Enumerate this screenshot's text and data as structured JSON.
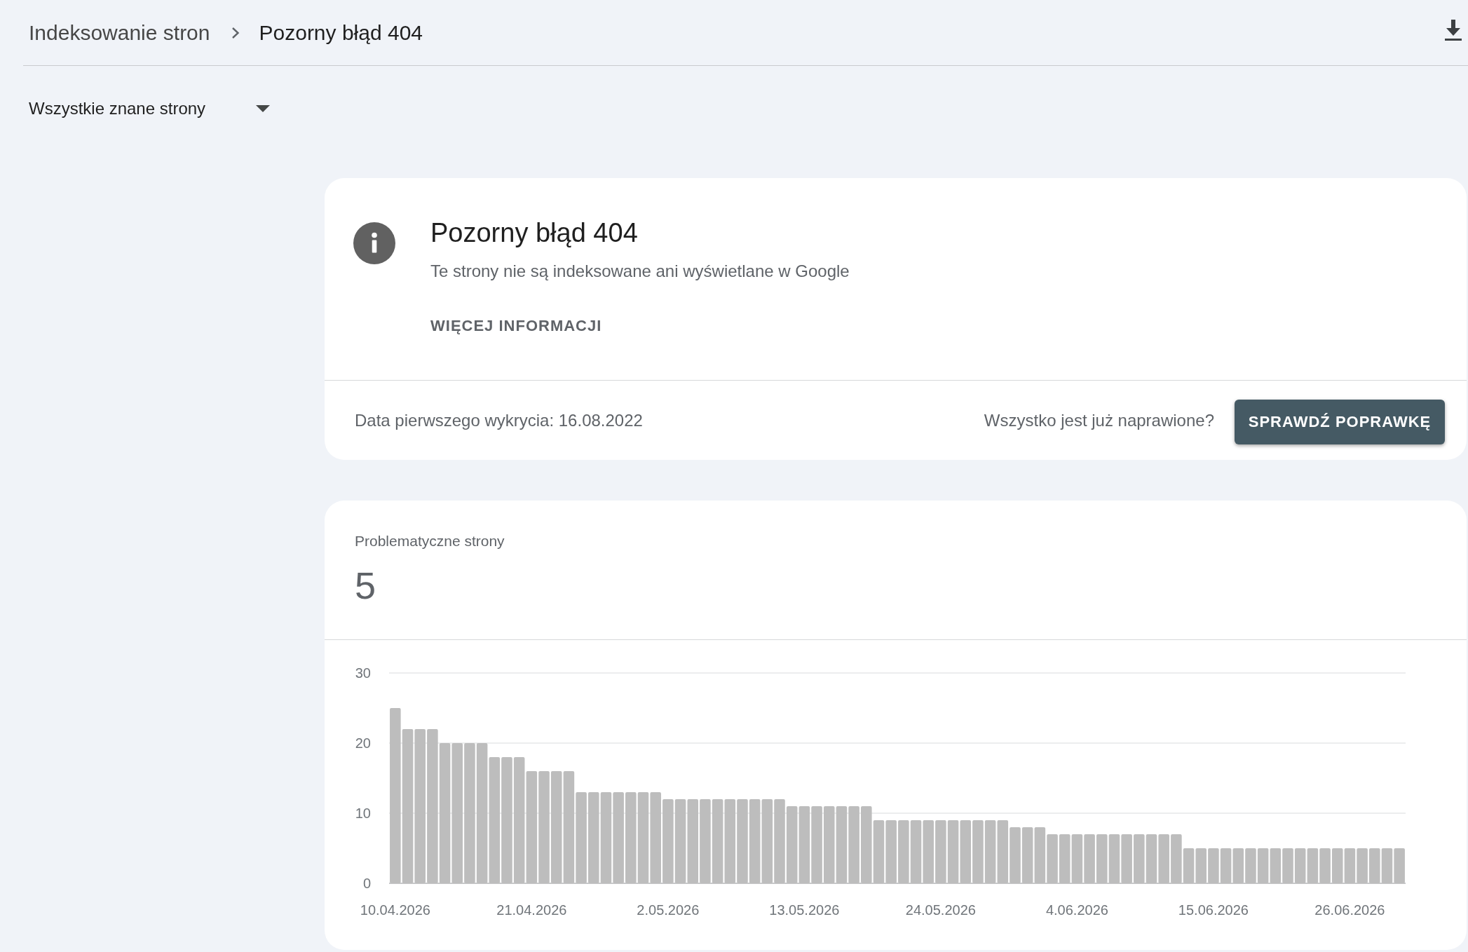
{
  "breadcrumb": {
    "parent": "Indeksowanie stron",
    "current": "Pozorny błąd 404"
  },
  "filter_dropdown": {
    "value": "Wszystkie znane strony"
  },
  "issue_card": {
    "title": "Pozorny błąd 404",
    "description": "Te strony nie są indeksowane ani wyświetlane w Google",
    "link": "WIĘCEJ INFORMACJI",
    "first_detected": "Data pierwszego wykrycia: 16.08.2022",
    "fixed_question": "Wszystko jest już naprawione?",
    "validate_button": "SPRAWDŹ POPRAWKĘ"
  },
  "pages_card": {
    "label": "Problematyczne strony",
    "count": "5",
    "chart_data": {
      "type": "bar",
      "ylim": [
        0,
        30
      ],
      "yticks": [
        0,
        10,
        20,
        30
      ],
      "values": [
        25,
        22,
        22,
        22,
        20,
        20,
        20,
        20,
        18,
        18,
        18,
        16,
        16,
        16,
        16,
        13,
        13,
        13,
        13,
        13,
        13,
        13,
        12,
        12,
        12,
        12,
        12,
        12,
        12,
        12,
        12,
        12,
        11,
        11,
        11,
        11,
        11,
        11,
        11,
        9,
        9,
        9,
        9,
        9,
        9,
        9,
        9,
        9,
        9,
        9,
        8,
        8,
        8,
        7,
        7,
        7,
        7,
        7,
        7,
        7,
        7,
        7,
        7,
        7,
        5,
        5,
        5,
        5,
        5,
        5,
        5,
        5,
        5,
        5,
        5,
        5,
        5,
        5,
        5,
        5,
        5,
        5
      ]
    },
    "date_labels": [
      "10.04.2026",
      "21.04.2026",
      "2.05.2026",
      "13.05.2026",
      "24.05.2026",
      "4.06.2026",
      "15.06.2026",
      "26.06.2026"
    ]
  }
}
